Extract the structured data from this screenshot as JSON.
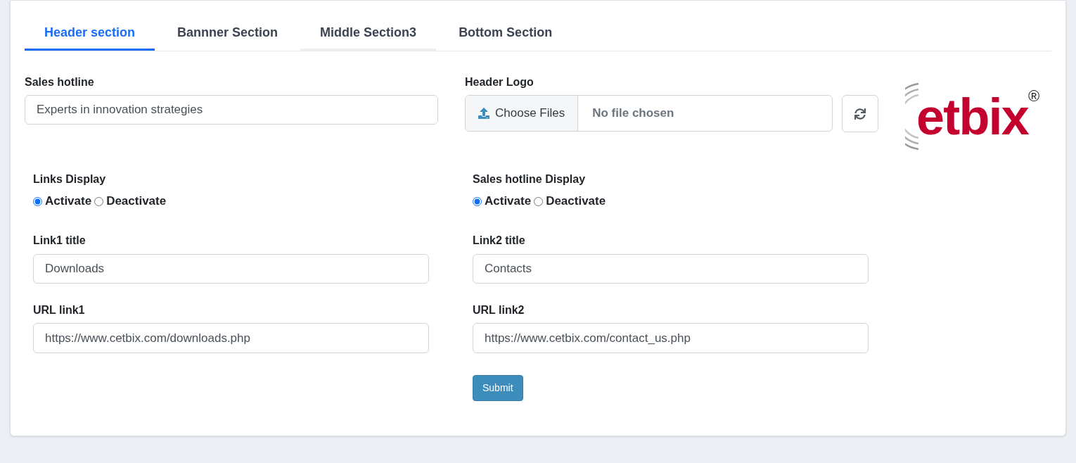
{
  "tabs": [
    {
      "label": "Header section",
      "selected": true,
      "hovered": false
    },
    {
      "label": "Bannner Section",
      "selected": false,
      "hovered": false
    },
    {
      "label": "Middle Section3",
      "selected": false,
      "hovered": true
    },
    {
      "label": "Bottom Section",
      "selected": false,
      "hovered": false
    }
  ],
  "sales_hotline": {
    "label": "Sales hotline",
    "value": "Experts in innovation strategies"
  },
  "header_logo": {
    "label": "Header Logo",
    "button": "Choose Files",
    "status": "No file chosen"
  },
  "logo": {
    "text": "etbix$^{®}$"
  },
  "columns": [
    {
      "display": {
        "label": "Links Display",
        "options": [
          {
            "label": "Activate",
            "selected": true
          },
          {
            "label": "Deactivate",
            "selected": false
          }
        ]
      },
      "title": {
        "label": "Link1 title",
        "value": "Downloads"
      },
      "url": {
        "label": "URL link1",
        "value": "https://www.cetbix.com/downloads.php"
      }
    },
    {
      "display": {
        "label": "Sales hotline Display",
        "options": [
          {
            "label": "Activate",
            "selected": true
          },
          {
            "label": "Deactivate",
            "selected": false
          }
        ]
      },
      "title": {
        "label": "Link2 title",
        "value": "Contacts"
      },
      "url": {
        "label": "URL link2",
        "value": "https://www.cetbix.com/contact_us.php"
      }
    }
  ],
  "submit": {
    "label": "Submit"
  }
}
